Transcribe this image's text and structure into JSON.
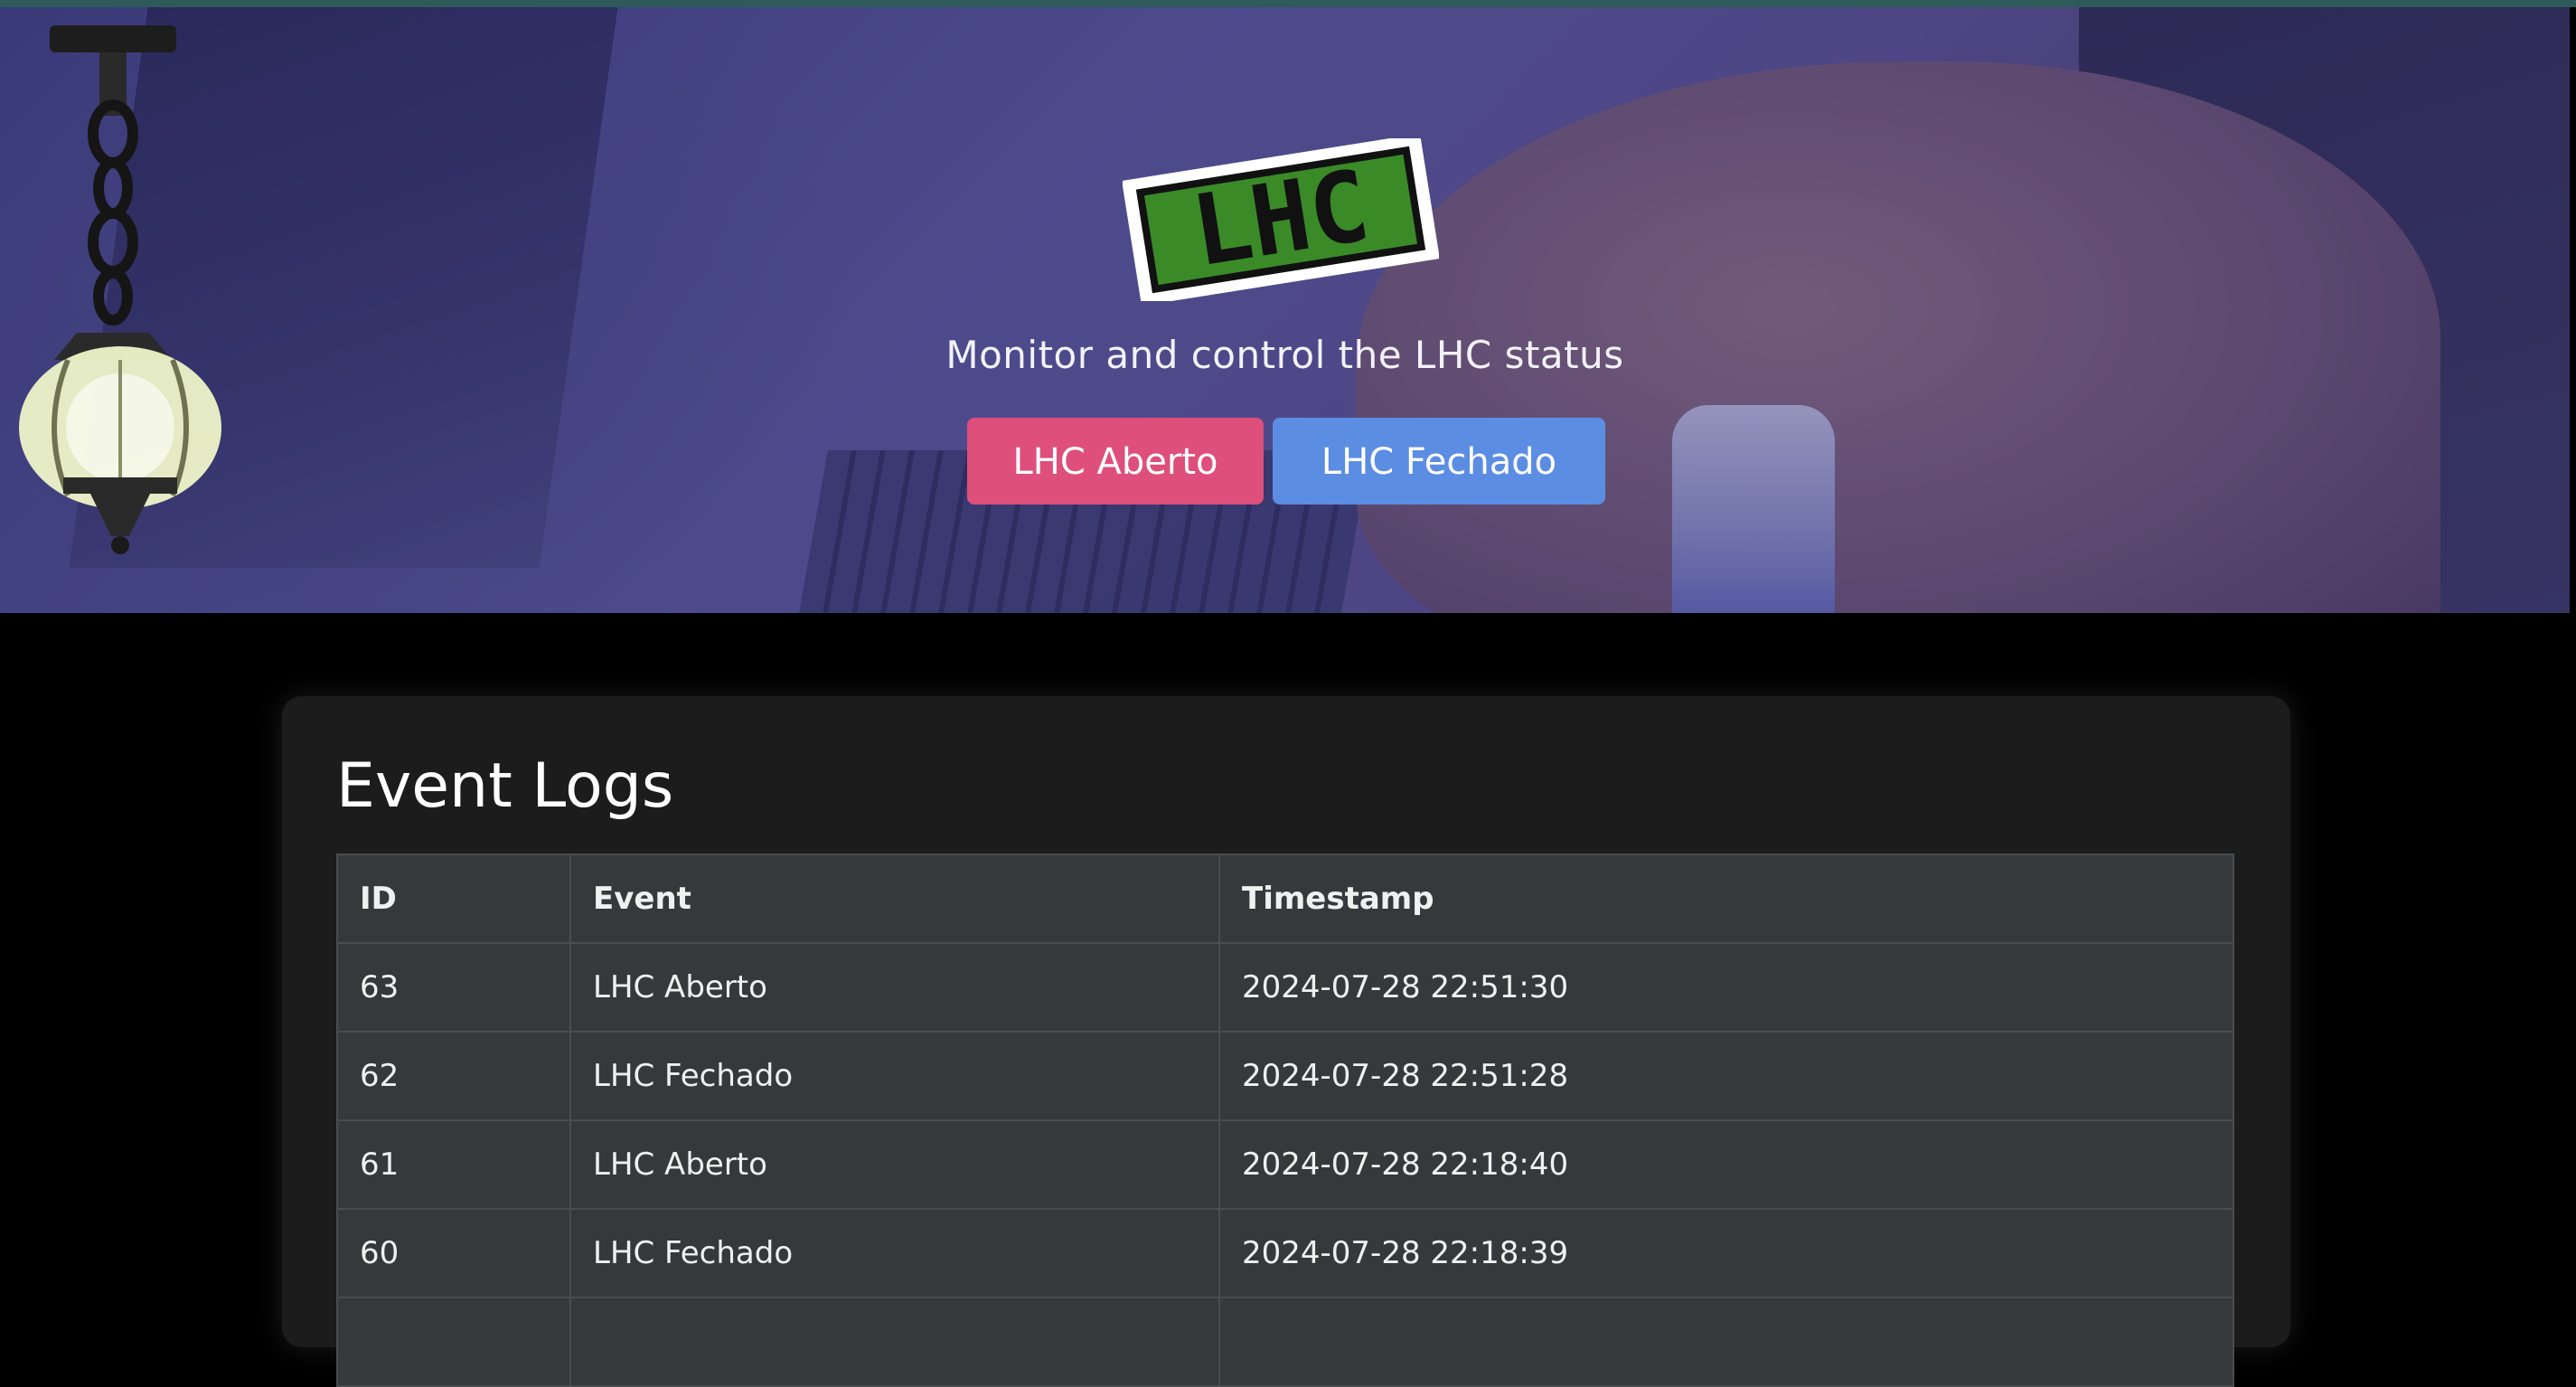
{
  "hero": {
    "subtitle": "Monitor and control the LHC status",
    "logo_text": "LHC",
    "buttons": {
      "open_label": "LHC Aberto",
      "closed_label": "LHC Fechado"
    }
  },
  "logs": {
    "title": "Event Logs",
    "columns": [
      "ID",
      "Event",
      "Timestamp"
    ],
    "rows": [
      {
        "id": "63",
        "event": "LHC Aberto",
        "timestamp": "2024-07-28 22:51:30"
      },
      {
        "id": "62",
        "event": "LHC Fechado",
        "timestamp": "2024-07-28 22:51:28"
      },
      {
        "id": "61",
        "event": "LHC Aberto",
        "timestamp": "2024-07-28 22:18:40"
      },
      {
        "id": "60",
        "event": "LHC Fechado",
        "timestamp": "2024-07-28 22:18:39"
      }
    ]
  },
  "colors": {
    "open_button": "#de4f7c",
    "closed_button": "#5b8de3",
    "logo_green": "#3a8a28",
    "panel_bg": "#1c1c1d",
    "table_bg": "#36383c"
  }
}
